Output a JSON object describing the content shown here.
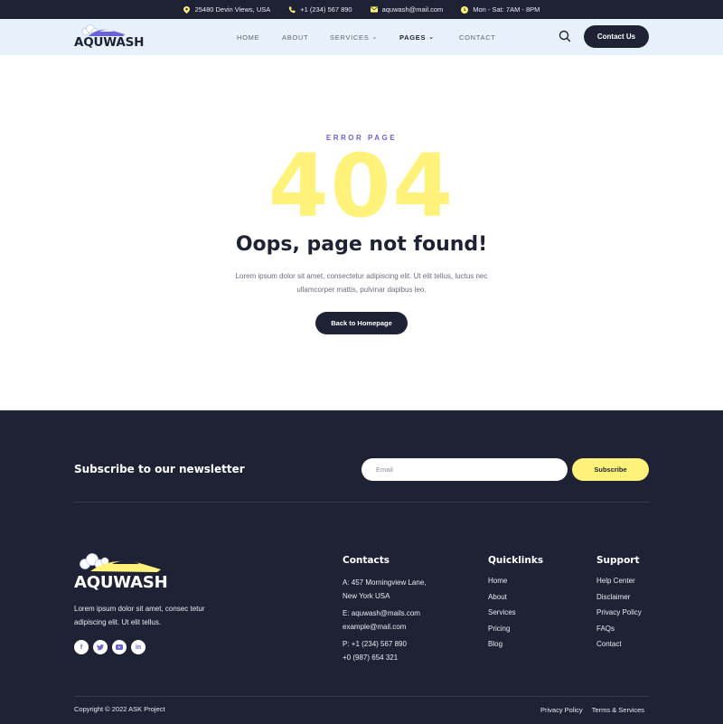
{
  "topbar": {
    "address": "25480 Devin Views, USA",
    "phone": "+1 (234) 567 890",
    "email": "aquwash@mail.com",
    "hours": "Mon - Sat: 7AM - 8PM"
  },
  "header": {
    "logo_text": "AQUWASH",
    "nav": [
      {
        "label": "HOME"
      },
      {
        "label": "ABOUT"
      },
      {
        "label": "SERVICES"
      },
      {
        "label": "PAGES"
      },
      {
        "label": "CONTACT"
      }
    ],
    "contact_button": "Contact Us"
  },
  "main": {
    "eyebrow": "ERROR PAGE",
    "code": "404",
    "headline": "Oops, page not found!",
    "description": "Lorem ipsum dolor sit amet, consectetur adipiscing elit. Ut elit tellus, luctus nec ullamcorper mattis, pulvinar dapibus leo.",
    "home_button": "Back to Homepage"
  },
  "newsletter": {
    "title": "Subscribe to our newsletter",
    "email_placeholder": "Email",
    "subscribe_button": "Subscribe"
  },
  "footer": {
    "logo_text": "AQUWASH",
    "description": "Lorem ipsum dolor sit amet, consec tetur adipiscing elit. Ut elit tellus.",
    "socials": [
      "facebook-icon",
      "twitter-icon",
      "youtube-icon",
      "linkedin-icon"
    ],
    "contacts": {
      "title": "Contacts",
      "address_line1": "A: 457 Morningview Lane,",
      "address_line2": "New York USA",
      "email_line1": "E: aquwash@mails.com",
      "email_line2": "example@mail.com",
      "phone_line1": "P: +1 (234) 567 890",
      "phone_line2": "+0 (987) 654 321"
    },
    "quicklinks": {
      "title": "Quicklinks",
      "items": [
        "Home",
        "About",
        "Services",
        "Pricing",
        "Blog"
      ]
    },
    "support": {
      "title": "Support",
      "items": [
        "Help Center",
        "Disclaimer",
        "Privacy Policy",
        "FAQs",
        "Contact"
      ]
    },
    "copyright": "Copyright © 2022 ASK Project",
    "bottom_links": [
      "Privacy Policy",
      "Terms & Services"
    ]
  },
  "colors": {
    "dark": "#1f2235",
    "accent_yellow": "#fff27a",
    "accent_purple": "#6b62d8",
    "header_bg": "#e6f1fb"
  }
}
